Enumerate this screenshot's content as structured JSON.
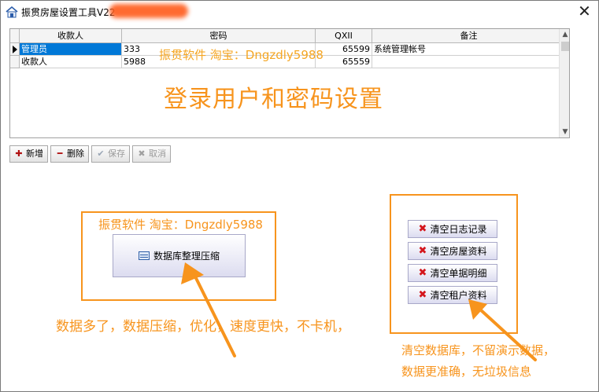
{
  "window": {
    "title": "振贯房屋设置工具V22",
    "close_glyph": "✕"
  },
  "grid": {
    "columns": [
      "收款人",
      "密码",
      "QXII",
      "备注"
    ],
    "rows": [
      {
        "name": "管理员",
        "password": "333",
        "qx": "65599",
        "note": "系统管理帐号"
      },
      {
        "name": "收款人",
        "password": "5988",
        "qx": "65559",
        "note": ""
      }
    ],
    "overlay_text": "振贯软件  淘宝：Dngzdly5988",
    "big_title": "登录用户和密码设置"
  },
  "toolbar": {
    "add": "新增",
    "delete": "删除",
    "save": "保存",
    "cancel": "取消"
  },
  "compress": {
    "caption": "振贯软件  淘宝：Dngzdly5988",
    "button_label": "数据库整理压缩",
    "note": "数据多了，数据压缩，优化，速度更快，不卡机，"
  },
  "clear": {
    "buttons": [
      "清空日志记录",
      "清空房屋资料",
      "清空单据明细",
      "清空租户资料"
    ],
    "note_line1": "清空数据库，不留演示数据，",
    "note_line2": "数据更准确，无垃圾信息"
  },
  "icons": {
    "app": "house-icon",
    "close": "close-icon",
    "add": "plus-icon",
    "delete": "minus-icon",
    "save": "check-icon",
    "cancel": "x-icon",
    "compress": "database-icon",
    "clear": "red-x-icon"
  },
  "colors": {
    "annotation": "#f7941d",
    "selection": "#0078d7",
    "red_x": "#d4161c"
  }
}
